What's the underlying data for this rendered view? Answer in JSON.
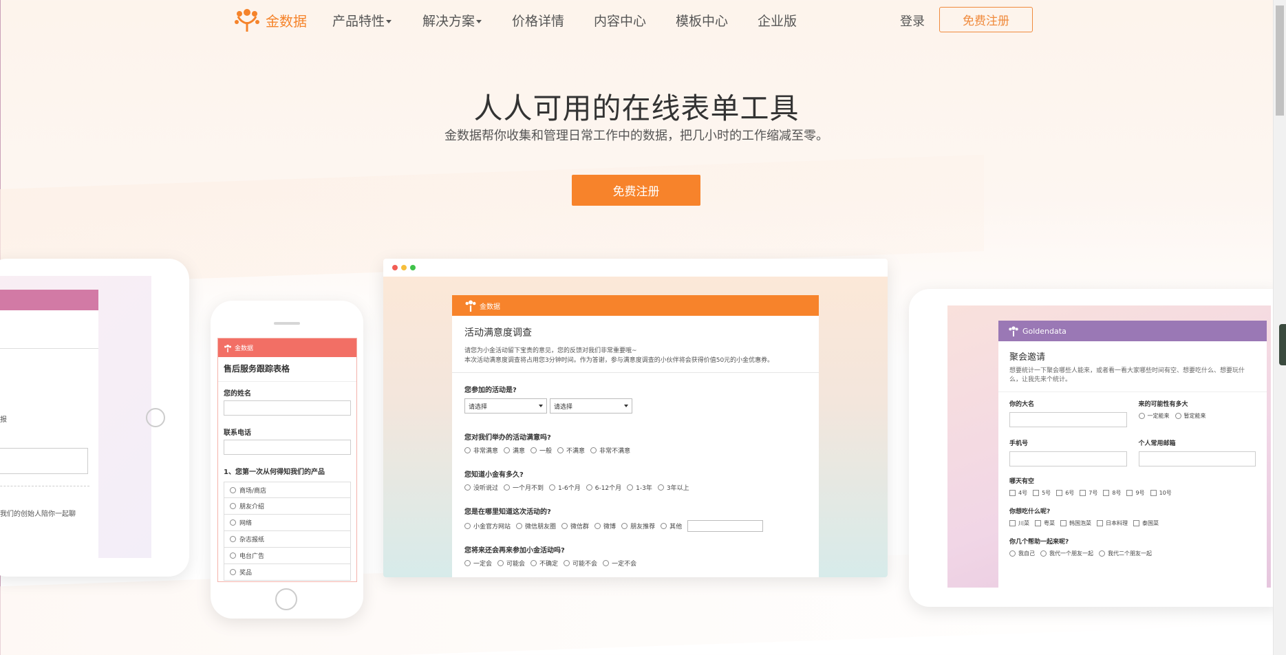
{
  "nav": {
    "logo_text": "金数据",
    "items": [
      "产品特性",
      "解决方案",
      "价格详情",
      "内容中心",
      "模板中心",
      "企业版"
    ],
    "login": "登录",
    "register": "免费注册"
  },
  "hero": {
    "title": "人人可用的在线表单工具",
    "subtitle": "金数据帮你收集和管理日常工作中的数据，把几小时的工作缩减至零。",
    "cta": "免费注册"
  },
  "left_tablet": {
    "text1": "动简报",
    "text2": "请来我们的创始人陪你一起聊"
  },
  "phone_form": {
    "brand": "金数据",
    "title": "售后服务跟踪表格",
    "name_label": "您的姓名",
    "phone_label": "联系电话",
    "question": "1、您第一次从何得知我们的产品",
    "options": [
      "商场/商店",
      "朋友介绍",
      "网络",
      "杂志报纸",
      "电台广告",
      "奖品"
    ]
  },
  "browser_form": {
    "brand": "金数据",
    "title": "活动满意度调查",
    "desc1": "请您为小金活动留下宝贵的意见，您的反馈对我们非常重要哦~",
    "desc2": "本次活动满意度调查将占用您3分钟时间。作为答谢，参与满意度调查的小伙伴将会获得价值50元的小金优惠券。",
    "q1": "您参加的活动是?",
    "select1": "请选择",
    "select2": "请选择",
    "q2": "您对我们举办的活动满意吗?",
    "q2_options": [
      "非常满意",
      "满意",
      "一般",
      "不满意",
      "非常不满意"
    ],
    "q3": "您知道小金有多久?",
    "q3_options": [
      "没听说过",
      "一个月不到",
      "1-6个月",
      "6-12个月",
      "1-3年",
      "3年以上"
    ],
    "q4": "您是在哪里知道这次活动的?",
    "q4_options": [
      "小金官方网站",
      "微信朋友圈",
      "微信群",
      "微博",
      "朋友推荐",
      "其他"
    ],
    "q5": "您将来还会再来参加小金活动吗?",
    "q5_options": [
      "一定会",
      "可能会",
      "不确定",
      "可能不会",
      "一定不会"
    ]
  },
  "right_form": {
    "brand": "Goldendata",
    "title": "聚会邀请",
    "desc": "想要统计一下聚会哪些人能来，或者看一看大家哪些时间有空、想要吃什么、想要玩什么，让我先来个统计。",
    "name_label": "你的大名",
    "likely_label": "来的可能性有多大",
    "likely_options": [
      "一定能来",
      "暂定能来"
    ],
    "phone_label": "手机号",
    "email_label": "个人常用邮箱",
    "days_label": "哪天有空",
    "days": [
      "4号",
      "5号",
      "6号",
      "7号",
      "8号",
      "9号",
      "10号"
    ],
    "food_label": "你想吃什么呢?",
    "food": [
      "川菜",
      "粤菜",
      "韩国泡菜",
      "日本料理",
      "泰国菜"
    ],
    "help_label": "你几个帮助一起来呢?",
    "help": [
      "我自己",
      "我代一个朋友一起",
      "我代二个朋友一起"
    ]
  }
}
